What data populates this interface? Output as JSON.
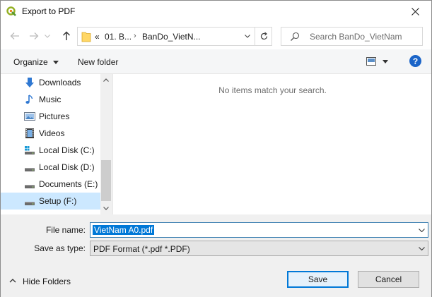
{
  "window": {
    "title": "Export to PDF",
    "app_icon": "qgis-icon"
  },
  "address_bar": {
    "overflow": "«",
    "crumbs": [
      "01. B...",
      "BanDo_VietN..."
    ],
    "separator": "›"
  },
  "search": {
    "placeholder": "Search BanDo_VietNam"
  },
  "toolbar": {
    "organize_label": "Organize",
    "new_folder_label": "New folder",
    "help_label": "?"
  },
  "nav_pane": {
    "items": [
      {
        "label": "Downloads",
        "icon": "download-arrow-icon"
      },
      {
        "label": "Music",
        "icon": "music-note-icon"
      },
      {
        "label": "Pictures",
        "icon": "pictures-icon"
      },
      {
        "label": "Videos",
        "icon": "videos-icon"
      },
      {
        "label": "Local Disk (C:)",
        "icon": "system-drive-icon"
      },
      {
        "label": "Local Disk (D:)",
        "icon": "drive-icon"
      },
      {
        "label": "Documents (E:)",
        "icon": "drive-icon"
      },
      {
        "label": "Setup (F:)",
        "icon": "drive-icon",
        "selected": true
      }
    ]
  },
  "content": {
    "empty_message": "No items match your search."
  },
  "form": {
    "file_name_label": "File name:",
    "file_name_value": "VietNam A0.pdf",
    "save_type_label": "Save as type:",
    "save_type_value": "PDF Format (*.pdf *.PDF)"
  },
  "footer": {
    "hide_folders_label": "Hide Folders",
    "save_label": "Save",
    "cancel_label": "Cancel"
  },
  "colors": {
    "accent": "#0078d7",
    "selection": "#cce8ff",
    "help_blue": "#1a64c8"
  }
}
